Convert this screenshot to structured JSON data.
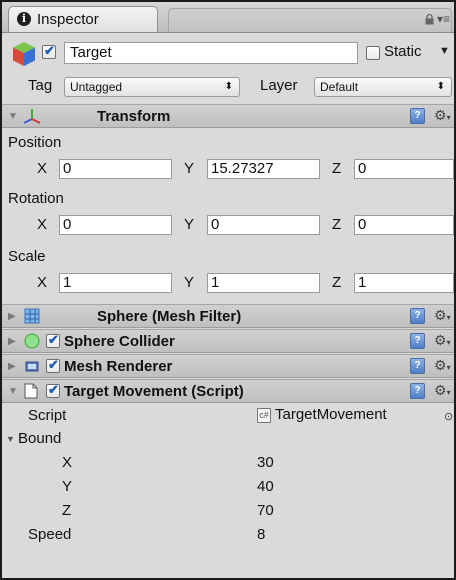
{
  "tab": {
    "title": "Inspector",
    "lock_glyph": "🔒",
    "menu_glyph": "▾≡"
  },
  "object": {
    "active": true,
    "name": "Target",
    "static_label": "Static",
    "static_checked": false
  },
  "tag": {
    "label": "Tag",
    "value": "Untagged"
  },
  "layer": {
    "label": "Layer",
    "value": "Default"
  },
  "transform": {
    "title": "Transform",
    "position": {
      "label": "Position",
      "x": "0",
      "y": "15.27327",
      "z": "0"
    },
    "rotation": {
      "label": "Rotation",
      "x": "0",
      "y": "0",
      "z": "0"
    },
    "scale": {
      "label": "Scale",
      "x": "1",
      "y": "1",
      "z": "1"
    },
    "axes": {
      "x": "X",
      "y": "Y",
      "z": "Z"
    }
  },
  "components": [
    {
      "title": "Sphere (Mesh Filter)",
      "icon": "mesh-filter-icon",
      "has_checkbox": false
    },
    {
      "title": "Sphere Collider",
      "icon": "sphere-collider-icon",
      "has_checkbox": true,
      "checked": true
    },
    {
      "title": "Mesh Renderer",
      "icon": "mesh-renderer-icon",
      "has_checkbox": true,
      "checked": true
    }
  ],
  "script_component": {
    "title": "Target Movement (Script)",
    "checked": true,
    "script_label": "Script",
    "script_value": "TargetMovement",
    "bound_label": "Bound",
    "bound": {
      "x_label": "X",
      "x": "30",
      "y_label": "Y",
      "y": "40",
      "z_label": "Z",
      "z": "70"
    },
    "speed_label": "Speed",
    "speed": "8"
  },
  "colors": {
    "panel_bg": "#dadada",
    "header_bg": "#c6c6c6",
    "check_blue": "#1e5cb3",
    "help_blue": "#4f7fc6"
  }
}
